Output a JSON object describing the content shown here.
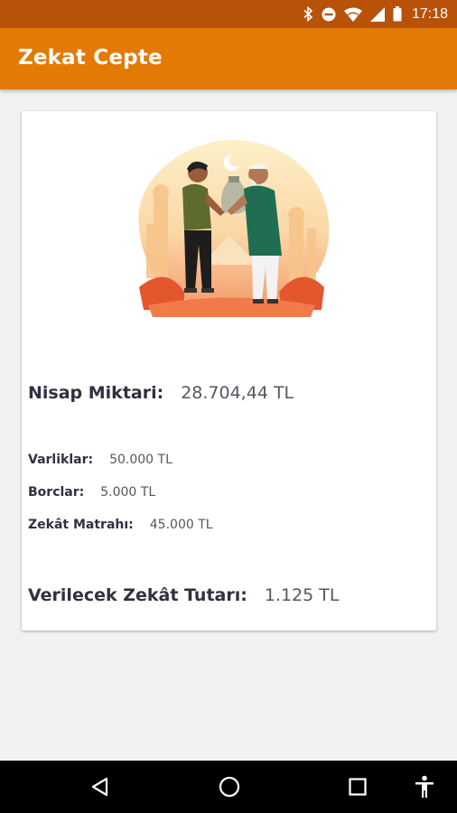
{
  "status_bar": {
    "time": "17:18",
    "icons": [
      "bluetooth-icon",
      "do-not-disturb-icon",
      "wifi-icon",
      "signal-icon",
      "battery-icon"
    ]
  },
  "app_bar": {
    "title": "Zekat Cepte"
  },
  "card": {
    "illustration": "zakat-giving-illustration",
    "nisap": {
      "label": "Nisap Miktari:",
      "value": "28.704,44 TL"
    },
    "assets": {
      "label": "Varliklar:",
      "value": "50.000 TL"
    },
    "debts": {
      "label": "Borclar:",
      "value": "5.000 TL"
    },
    "base": {
      "label": "Zekât Matrahı:",
      "value": "45.000 TL"
    },
    "total": {
      "label": "Verilecek Zekât Tutarı:",
      "value": "1.125 TL"
    }
  },
  "nav_bar": {
    "buttons": [
      "back-icon",
      "home-icon",
      "recents-icon",
      "accessibility-icon"
    ]
  },
  "colors": {
    "status_bar": "#b85208",
    "app_bar": "#e47a06",
    "background": "#f2f2f4",
    "card": "#ffffff"
  }
}
